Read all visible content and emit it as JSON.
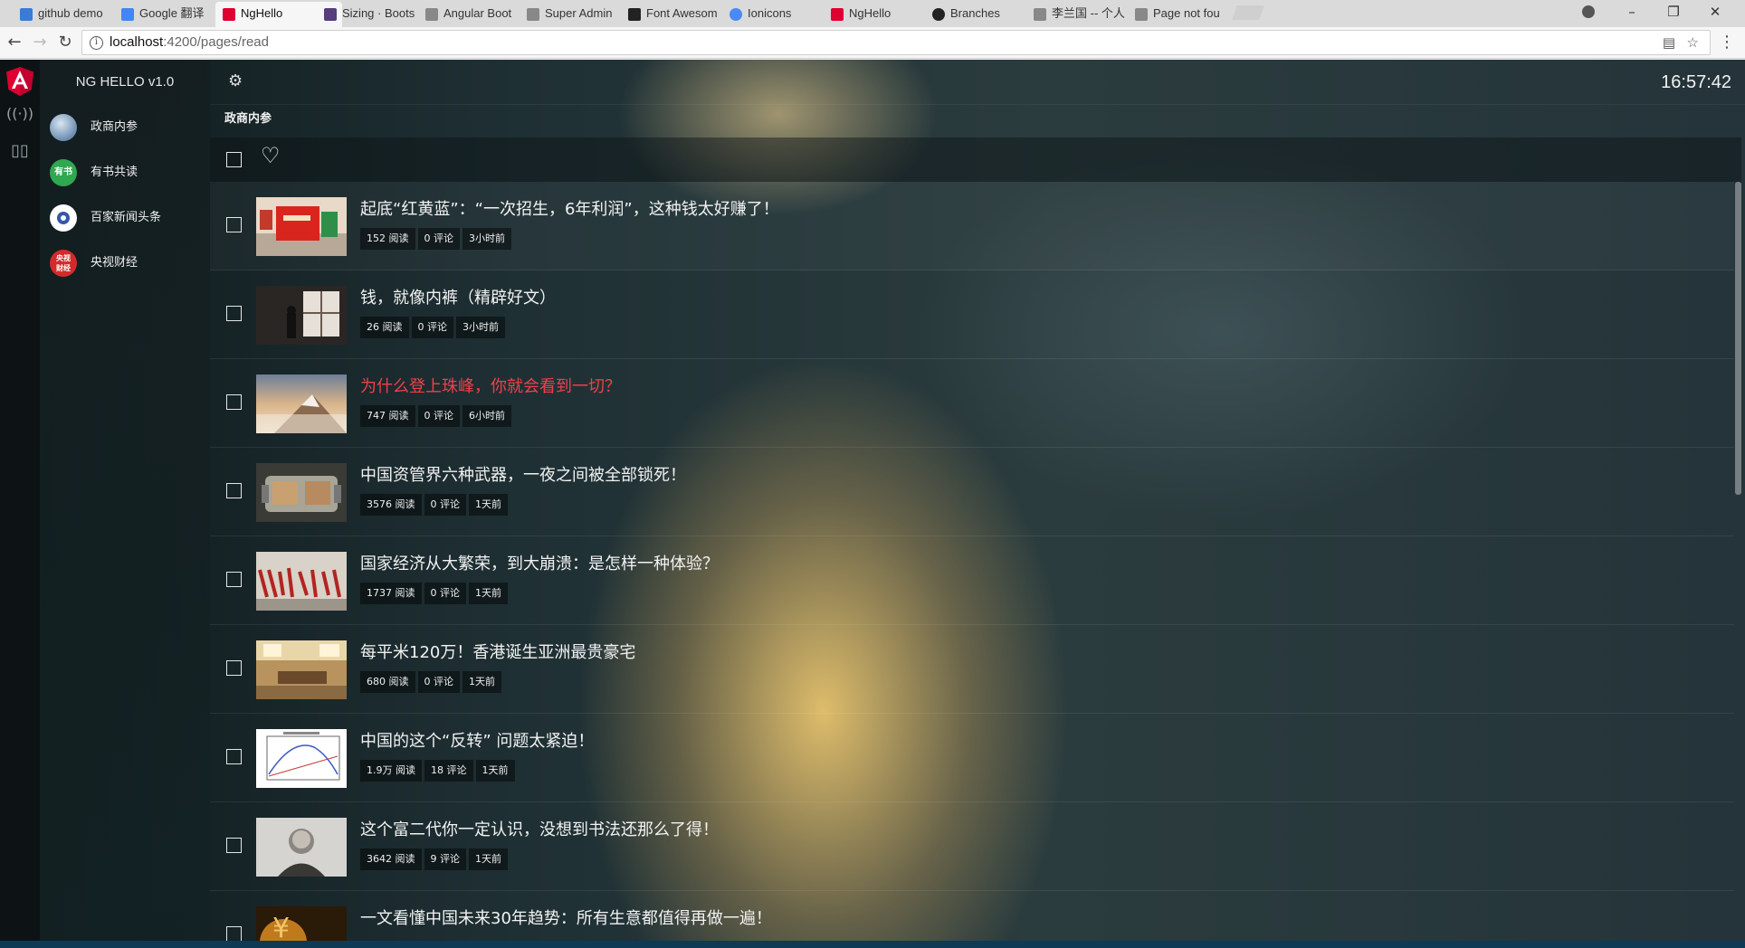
{
  "browser": {
    "tabs": [
      {
        "title": "github demo",
        "fav_color": "#3a7bd5"
      },
      {
        "title": "Google 翻译",
        "fav_color": "#4285f4"
      },
      {
        "title": "NgHello",
        "fav_color": "#dd0031",
        "active": true
      },
      {
        "title": "Sizing · Boots",
        "fav_color": "#563d7c"
      },
      {
        "title": "Angular Boot",
        "fav_color": "#888888"
      },
      {
        "title": "Super Admin",
        "fav_color": "#888888"
      },
      {
        "title": "Font Awesom",
        "fav_color": "#222222"
      },
      {
        "title": "Ionicons",
        "fav_color": "#4a8af4"
      },
      {
        "title": "NgHello",
        "fav_color": "#dd0031"
      },
      {
        "title": "Branches",
        "fav_color": "#222222"
      },
      {
        "title": "李兰国 -- 个人",
        "fav_color": "#888888"
      },
      {
        "title": "Page not fou",
        "fav_color": "#888888"
      }
    ],
    "url_host": "localhost",
    "url_path": ":4200/pages/read"
  },
  "app": {
    "brand": "NG HELLO v1.0",
    "clock": "16:57:42",
    "breadcrumb": "政商内参",
    "sidebar": [
      {
        "label": "政商内参",
        "badge": "",
        "color": "#7a9ec8"
      },
      {
        "label": "有书共读",
        "badge": "有书",
        "color": "#2fa84f"
      },
      {
        "label": "百家新闻头条",
        "badge": "",
        "color": "#ffffff"
      },
      {
        "label": "央视财经",
        "badge": "央视\n财经",
        "color": "#d42a2a"
      }
    ]
  },
  "articles": [
    {
      "title": "起底“红黄蓝”：“一次招生，6年利润”，这种钱太好赚了！",
      "reads": "152 阅读",
      "comments": "0 评论",
      "time": "3小时前",
      "hot": false
    },
    {
      "title": "钱，就像内裤（精辟好文）",
      "reads": "26 阅读",
      "comments": "0 评论",
      "time": "3小时前",
      "hot": false
    },
    {
      "title": "为什么登上珠峰，你就会看到一切？",
      "reads": "747 阅读",
      "comments": "0 评论",
      "time": "6小时前",
      "hot": true
    },
    {
      "title": "中国资管界六种武器，一夜之间被全部锁死！",
      "reads": "3576 阅读",
      "comments": "0 评论",
      "time": "1天前",
      "hot": false
    },
    {
      "title": "国家经济从大繁荣，到大崩溃：是怎样一种体验？",
      "reads": "1737 阅读",
      "comments": "0 评论",
      "time": "1天前",
      "hot": false
    },
    {
      "title": "每平米120万！香港诞生亚洲最贵豪宅",
      "reads": "680 阅读",
      "comments": "0 评论",
      "time": "1天前",
      "hot": false
    },
    {
      "title": "中国的这个“反转” 问题太紧迫！",
      "reads": "1.9万 阅读",
      "comments": "18 评论",
      "time": "1天前",
      "hot": false
    },
    {
      "title": "这个富二代你一定认识，没想到书法还那么了得！",
      "reads": "3642 阅读",
      "comments": "9 评论",
      "time": "1天前",
      "hot": false
    },
    {
      "title": "一文看懂中国未来30年趋势：所有生意都值得再做一遍！",
      "reads": "",
      "comments": "",
      "time": "",
      "hot": false
    }
  ]
}
